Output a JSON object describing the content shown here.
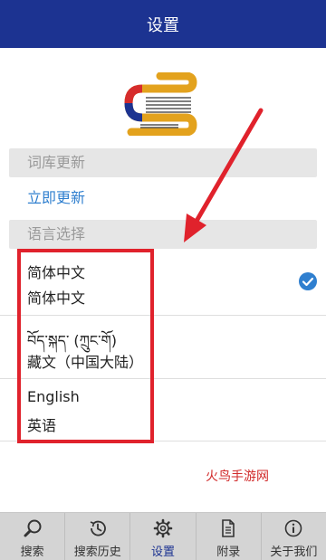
{
  "header": {
    "title": "设置"
  },
  "sections": {
    "dictionary_update": {
      "title": "词库更新",
      "update_now": "立即更新"
    },
    "language": {
      "title": "语言选择",
      "items": [
        {
          "line1": "简体中文",
          "line2": "简体中文",
          "selected": true
        },
        {
          "line1": "བོད་སྐད་ (ཀྲུང་གོ)",
          "line2": "藏文（中国大陆）",
          "selected": false
        },
        {
          "line1": "English",
          "line2": "英语",
          "selected": false
        }
      ]
    }
  },
  "watermark": "火鸟手游网",
  "nav": [
    {
      "label": "搜索",
      "icon": "search-icon"
    },
    {
      "label": "搜索历史",
      "icon": "history-icon"
    },
    {
      "label": "设置",
      "icon": "gear-icon",
      "active": true
    },
    {
      "label": "附录",
      "icon": "document-icon"
    },
    {
      "label": "关于我们",
      "icon": "info-icon"
    }
  ],
  "colors": {
    "header": "#1c3391",
    "link": "#2f7fcf",
    "annotation": "#e0222c",
    "check": "#2f7fcf"
  }
}
